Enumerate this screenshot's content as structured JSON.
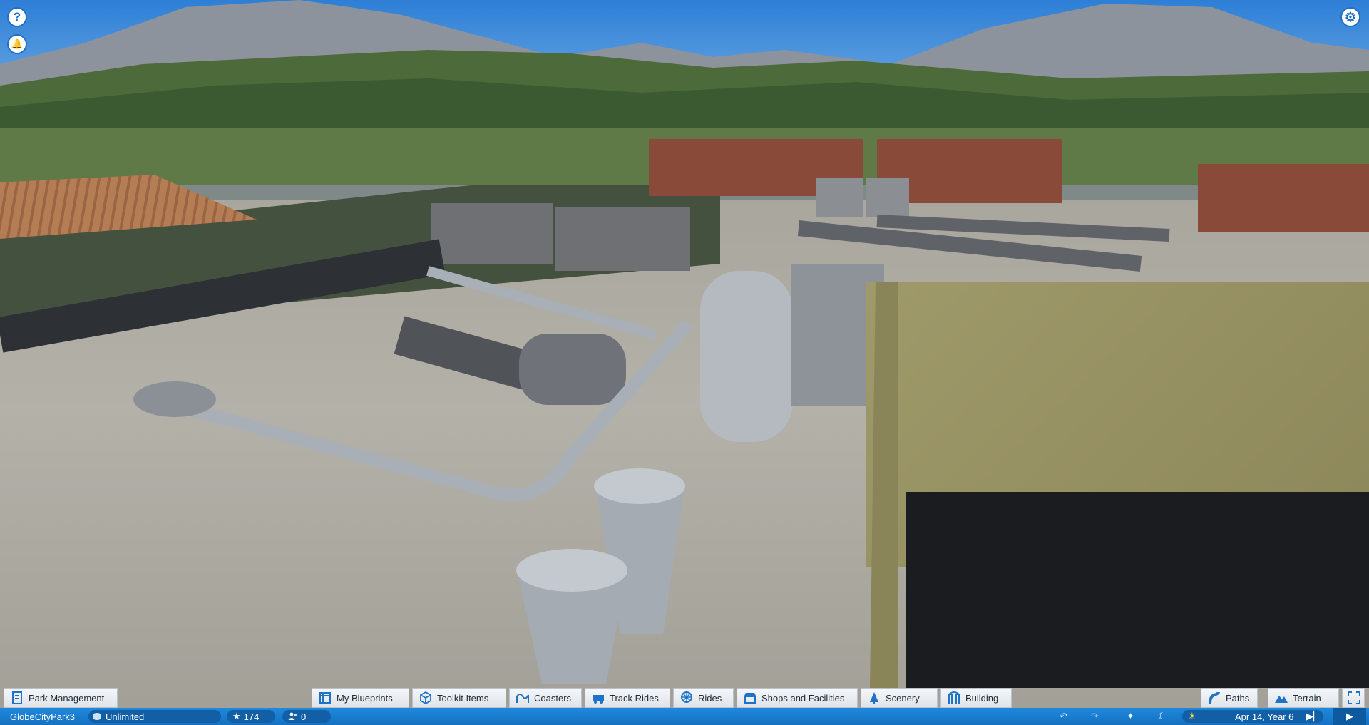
{
  "top_left_buttons": [
    {
      "icon": "help-icon",
      "glyph": "?"
    },
    {
      "icon": "bell-icon",
      "glyph": "🔔"
    }
  ],
  "top_right_button": {
    "icon": "gear-icon",
    "glyph": "⚙"
  },
  "toolbar": {
    "park_management": "Park Management",
    "my_blueprints": "My Blueprints",
    "toolkit_items": "Toolkit Items",
    "coasters": "Coasters",
    "track_rides": "Track Rides",
    "rides": "Rides",
    "shops_and_facilities": "Shops and Facilities",
    "scenery": "Scenery",
    "building": "Building",
    "paths": "Paths",
    "terrain": "Terrain"
  },
  "status": {
    "park_name": "GlobeCityPark3",
    "money": "Unlimited",
    "rating": "174",
    "guests": "0",
    "date": "Apr 14, Year 6"
  },
  "colors": {
    "accent": "#1e73c8",
    "statusbar": "#1a7fd2"
  }
}
